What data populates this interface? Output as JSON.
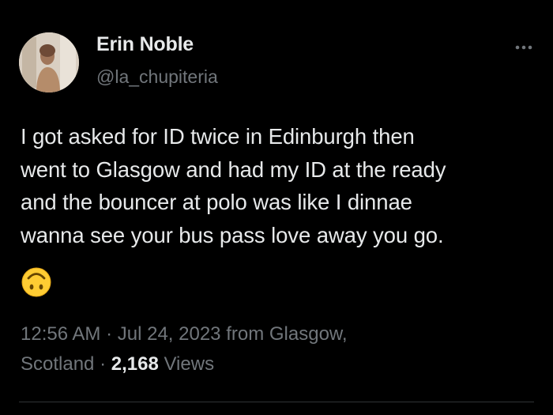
{
  "author": {
    "display_name": "Erin Noble",
    "handle": "@la_chupiteria"
  },
  "tweet": {
    "text": "I got asked for ID twice in Edinburgh then\nwent to Glasgow and had my ID at the ready\nand the bouncer at polo was like I dinnae\nwanna see your bus pass love away you go.",
    "emoji_icon": "upside-down-face-emoji"
  },
  "meta": {
    "time": "12:56 AM",
    "separator": "·",
    "date": "Jul 24, 2023",
    "from_label": "from",
    "location_line1": "Glasgow,",
    "location_line2": "Scotland",
    "views_count": "2,168",
    "views_label": "Views"
  },
  "menu": {
    "more_icon": "more-options-icon"
  },
  "colors": {
    "background": "#000000",
    "primary_text": "#e7e9ea",
    "secondary_text": "#71767b",
    "emoji_yellow": "#ffcc33"
  }
}
